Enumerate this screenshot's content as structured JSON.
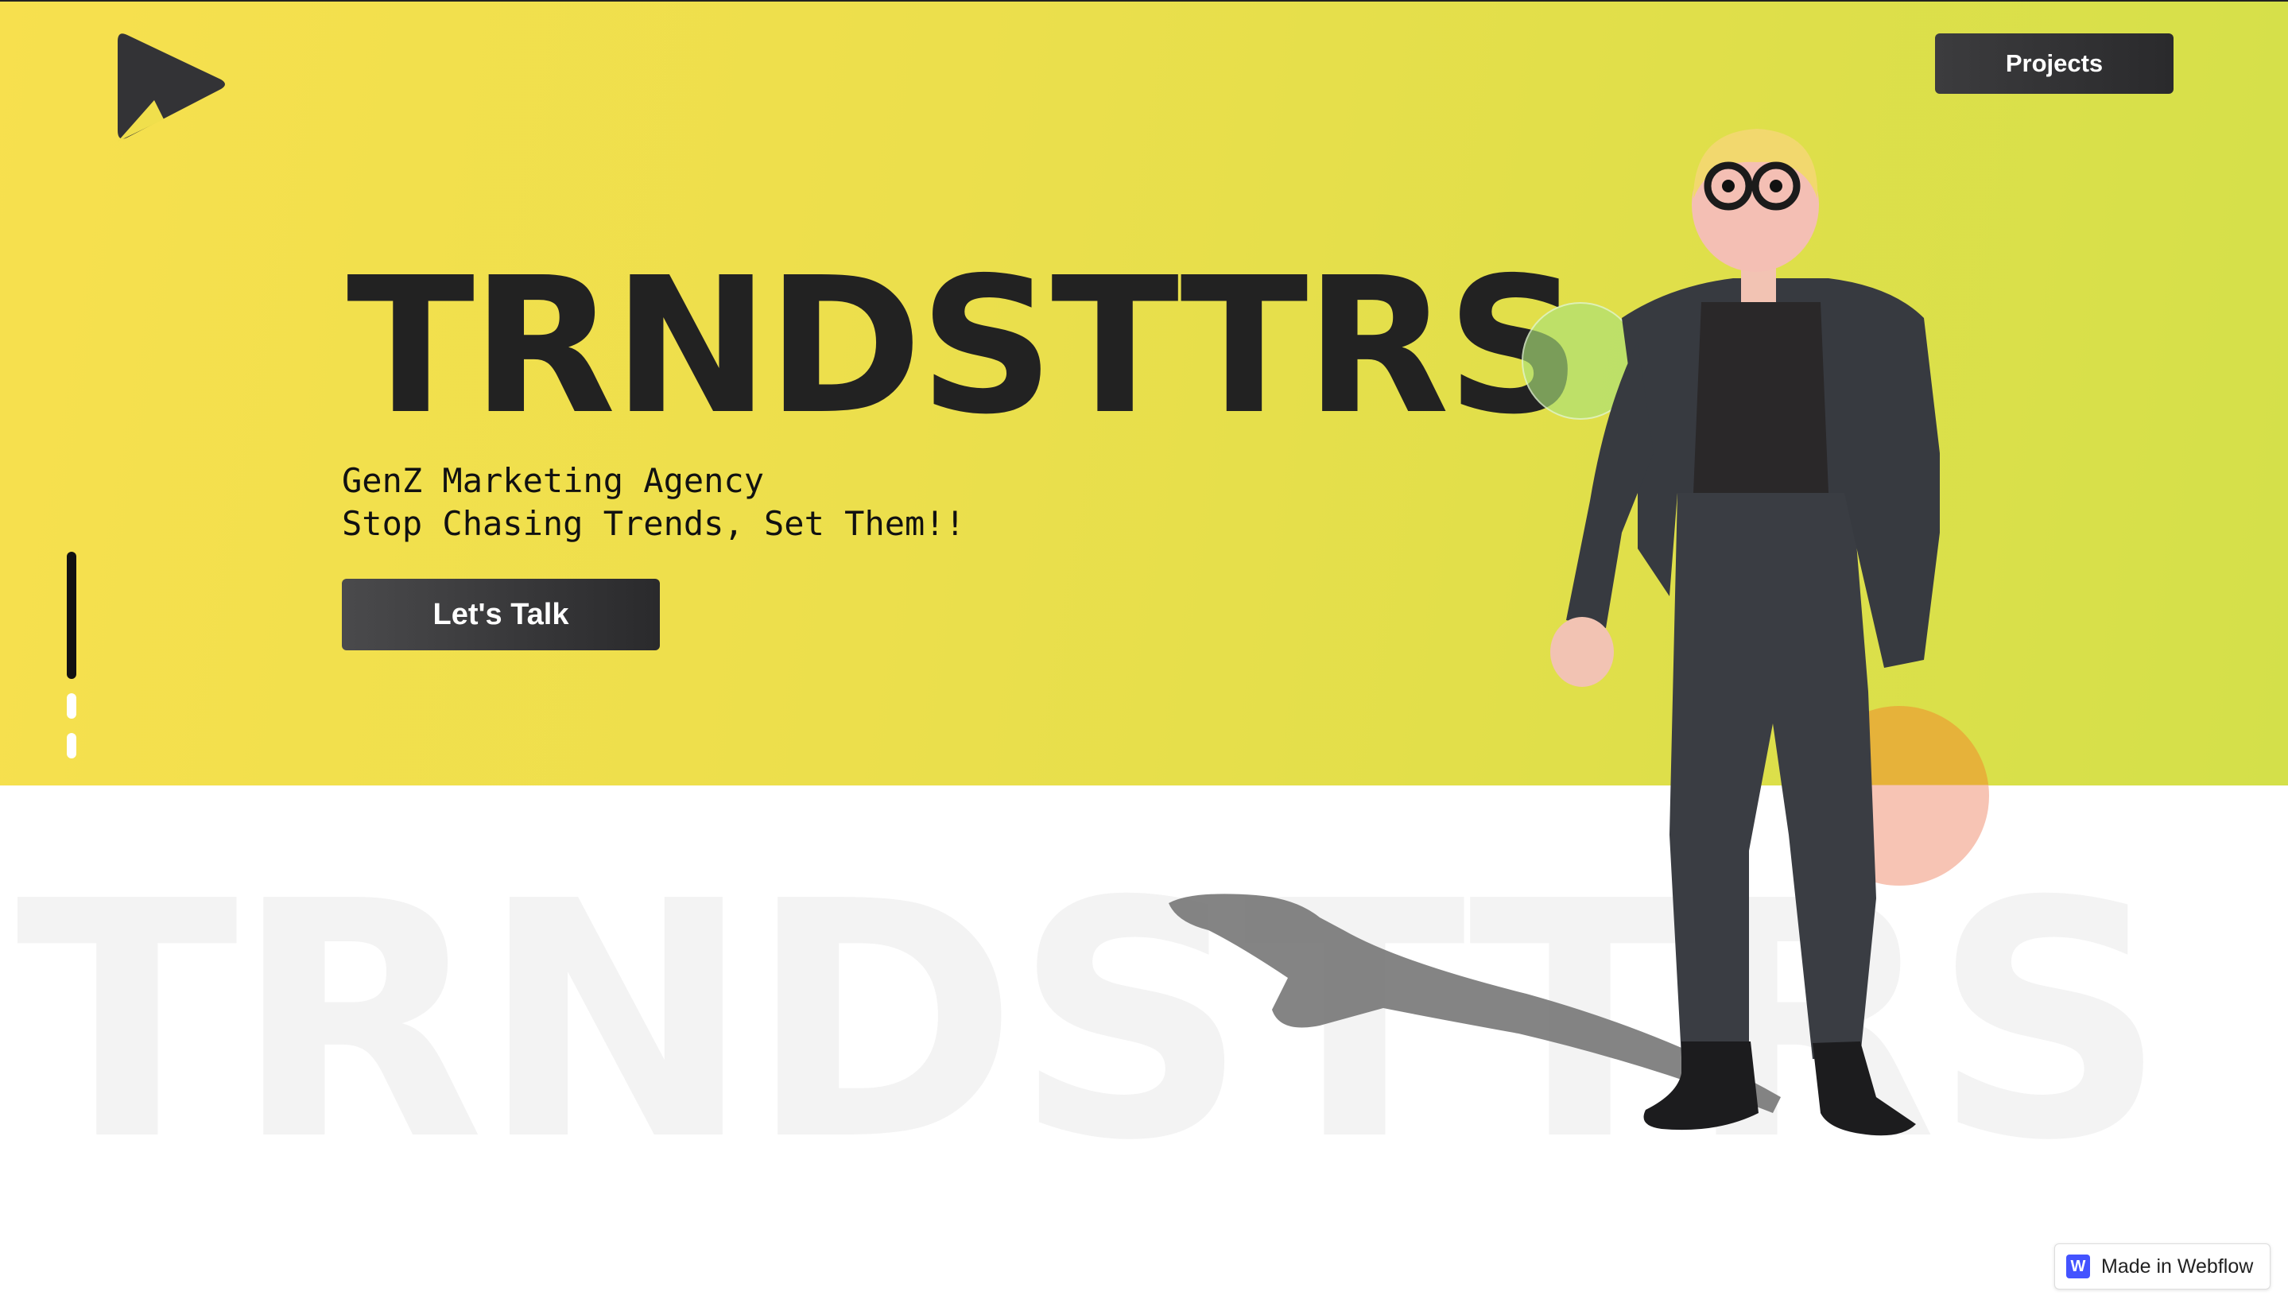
{
  "header": {
    "logo_icon": "play-triangle-icon",
    "projects_label": "Projects"
  },
  "hero": {
    "title": "TRNDSTTRS",
    "tagline_line1": "GenZ Marketing Agency",
    "tagline_line2": "Stop Chasing Trends, Set Them!!",
    "cta_label": "Let's Talk",
    "background_colors": [
      "#f7e04e",
      "#d4e04a"
    ]
  },
  "slider": {
    "slides": 3,
    "active_index": 0
  },
  "watermark": {
    "text": "TRNDSTTRS"
  },
  "badge": {
    "icon": "webflow-w-icon",
    "logo_letter": "W",
    "label": "Made in Webflow"
  },
  "colors": {
    "dark_button": "#2f2f31",
    "title_text": "#222222",
    "webflow_blue": "#4353ff"
  }
}
